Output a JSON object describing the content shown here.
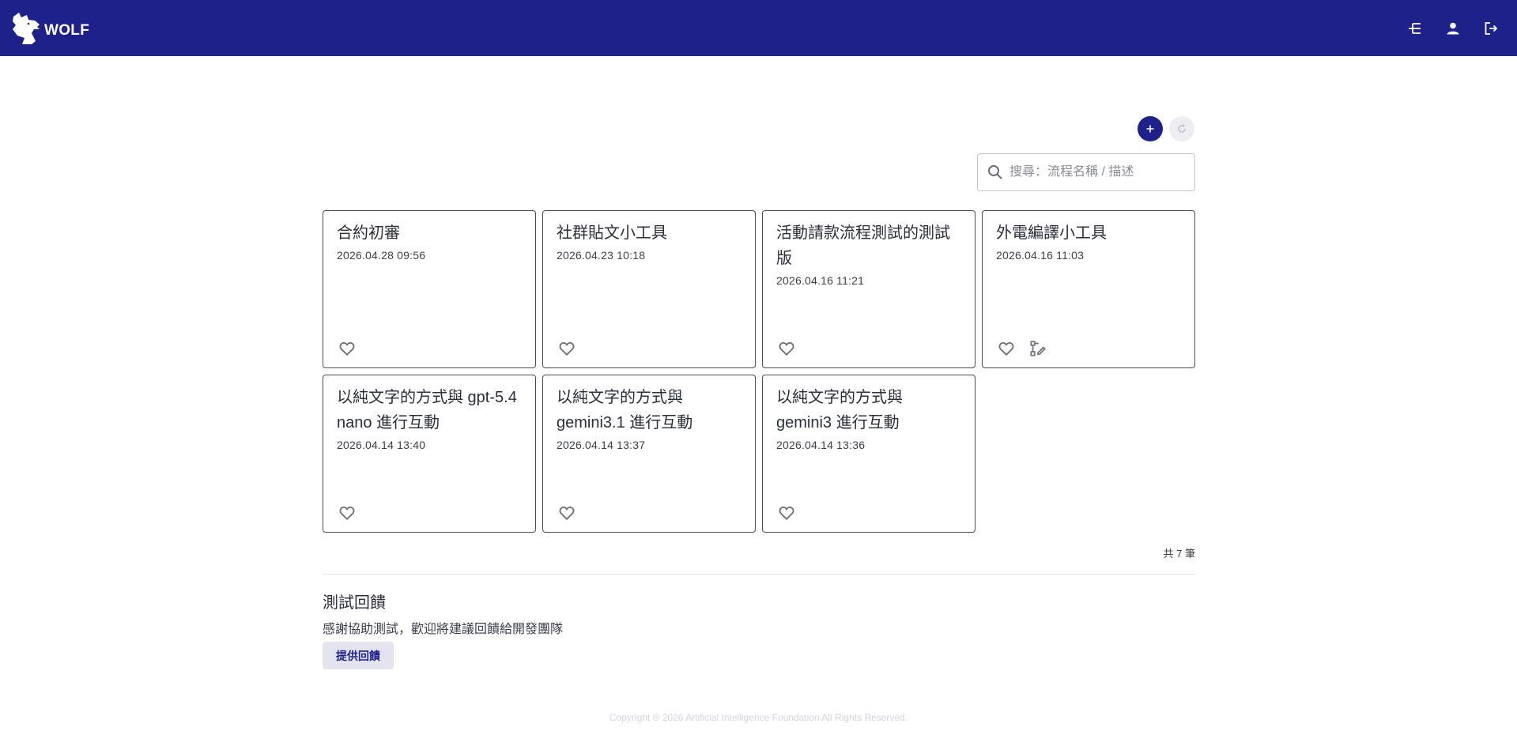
{
  "header": {
    "brand_name": "WOLF",
    "icons": {
      "flow": "flow-icon",
      "user": "user-icon",
      "logout": "logout-icon"
    },
    "bg_color": "#1e2189"
  },
  "toolbar": {
    "add_icon": "plus-icon",
    "refresh_icon": "refresh-icon"
  },
  "search": {
    "placeholder": "搜尋：流程名稱 / 描述",
    "value": ""
  },
  "cards": [
    {
      "title": "合約初審",
      "date": "2026.04.28 09:56",
      "favorited": false,
      "has_edit_flow": false
    },
    {
      "title": "社群貼文小工具",
      "date": "2026.04.23 10:18",
      "favorited": false,
      "has_edit_flow": false
    },
    {
      "title": "活動請款流程測試的測試版",
      "date": "2026.04.16 11:21",
      "favorited": false,
      "has_edit_flow": false
    },
    {
      "title": "外電編譯小工具",
      "date": "2026.04.16 11:03",
      "favorited": false,
      "has_edit_flow": true
    },
    {
      "title": "以純文字的方式與 gpt-5.4 nano 進行互動",
      "date": "2026.04.14 13:40",
      "favorited": false,
      "has_edit_flow": false
    },
    {
      "title": "以純文字的方式與 gemini3.1 進行互動",
      "date": "2026.04.14 13:37",
      "favorited": false,
      "has_edit_flow": false
    },
    {
      "title": "以純文字的方式與 gemini3 進行互動",
      "date": "2026.04.14 13:36",
      "favorited": false,
      "has_edit_flow": false
    }
  ],
  "total_count": "共 7 筆",
  "feedback": {
    "title": "測試回饋",
    "description": "感謝協助測試，歡迎將建議回饋給開發團隊",
    "button_label": "提供回饋"
  },
  "footer": {
    "copyright": "Copyright © 2026 Artificial Intelligence Foundation All Rights Reserved."
  }
}
